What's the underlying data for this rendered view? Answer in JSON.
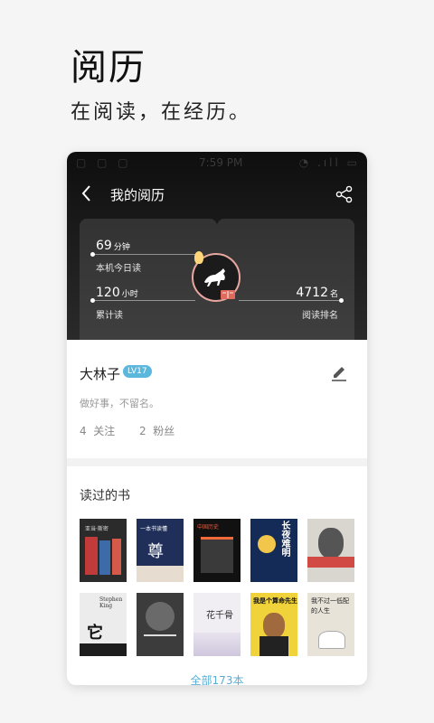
{
  "hero": {
    "title": "阅历",
    "subtitle": "在阅读，在经历。"
  },
  "statusbar": {
    "left": "▢ ▢ ▢",
    "time": "7:59 PM",
    "right": "◔ .ıll ▭"
  },
  "header": {
    "title": "我的阅历"
  },
  "stats": {
    "today": {
      "value": "69",
      "unit": "分钟",
      "label": "本机今日读"
    },
    "total": {
      "value": "120",
      "unit": "小时",
      "label": "累计读"
    },
    "rank": {
      "value": "4712",
      "unit": "名",
      "label": "阅读排名"
    }
  },
  "profile": {
    "name": "大林子",
    "level": "LV17",
    "motto": "做好事，不留名。",
    "following": {
      "count": "4",
      "label": "关注"
    },
    "followers": {
      "count": "2",
      "label": "粉丝"
    }
  },
  "books": {
    "title": "读过的书",
    "all_label": "全部173本",
    "items": [
      {
        "title": "亚当·斯密"
      },
      {
        "title": "一本书读懂"
      },
      {
        "title": "中国历史"
      },
      {
        "title": "长夜难明"
      },
      {
        "title": ""
      },
      {
        "title": "Stephen King"
      },
      {
        "title": ""
      },
      {
        "title": "花千骨"
      },
      {
        "title": "我是个算命先生"
      },
      {
        "title": "我不过一低配的人生"
      }
    ]
  },
  "colors": {
    "accent": "#5aaed6",
    "level_badge": "#5bb7dc"
  }
}
